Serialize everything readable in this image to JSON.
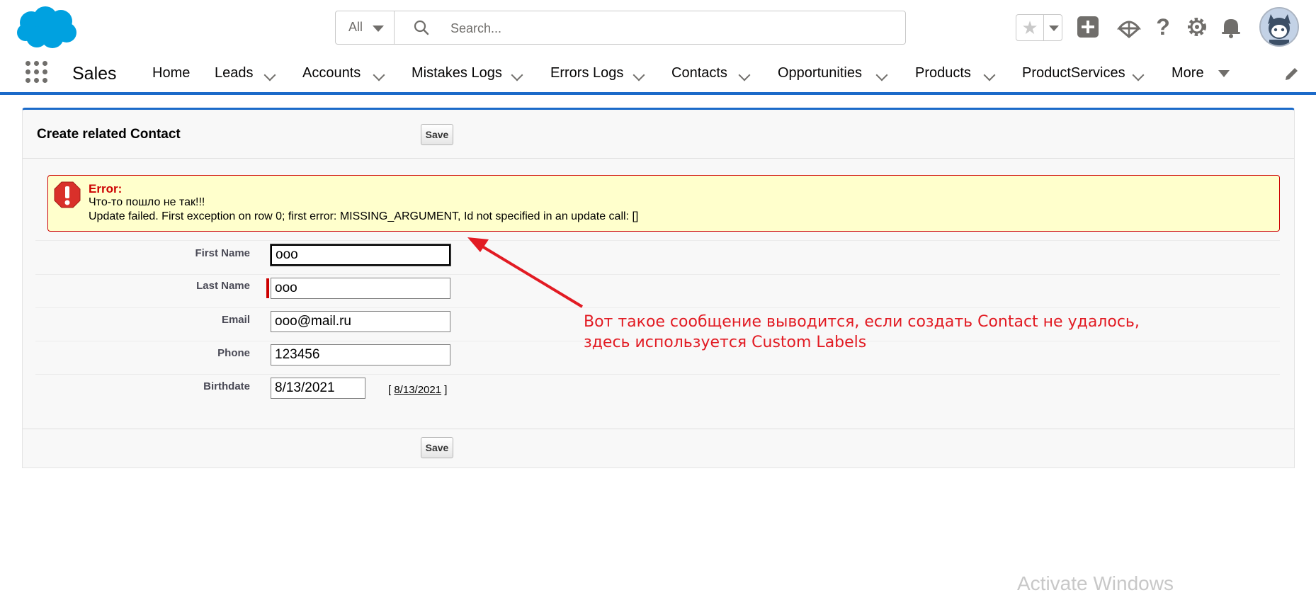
{
  "header": {
    "search_scope": "All",
    "search_placeholder": "Search...",
    "colors": {
      "brand_blue": "#1b6ac9",
      "logo_blue": "#00a1e0"
    }
  },
  "nav": {
    "app_name": "Sales",
    "items": [
      {
        "label": "Home",
        "dropdown": false
      },
      {
        "label": "Leads",
        "dropdown": true
      },
      {
        "label": "Accounts",
        "dropdown": true
      },
      {
        "label": "Mistakes Logs",
        "dropdown": true
      },
      {
        "label": "Errors Logs",
        "dropdown": true
      },
      {
        "label": "Contacts",
        "dropdown": true
      },
      {
        "label": "Opportunities",
        "dropdown": true
      },
      {
        "label": "Products",
        "dropdown": true
      },
      {
        "label": "ProductServices",
        "dropdown": true
      },
      {
        "label": "More",
        "dropdown": true
      }
    ]
  },
  "panel": {
    "title": "Create related Contact",
    "save_label": "Save",
    "error": {
      "title": "Error:",
      "line1": "Что-то пошло не так!!!",
      "line2": "Update failed. First exception on row 0; first error: MISSING_ARGUMENT, Id not specified in an update call: []"
    },
    "fields": {
      "first_name": {
        "label": "First Name",
        "value": "ooo"
      },
      "last_name": {
        "label": "Last Name",
        "value": "ooo"
      },
      "email": {
        "label": "Email",
        "value": "ooo@mail.ru"
      },
      "phone": {
        "label": "Phone",
        "value": "123456"
      },
      "birthdate": {
        "label": "Birthdate",
        "value": "8/13/2021",
        "today_link": "8/13/2021",
        "bracket_open": "[",
        "bracket_close": "]"
      }
    }
  },
  "annotation": {
    "line1": "Вот такое сообщение выводится, если создать Contact не удалось,",
    "line2": "здесь используется Custom Labels"
  },
  "watermark": "Activate Windows"
}
